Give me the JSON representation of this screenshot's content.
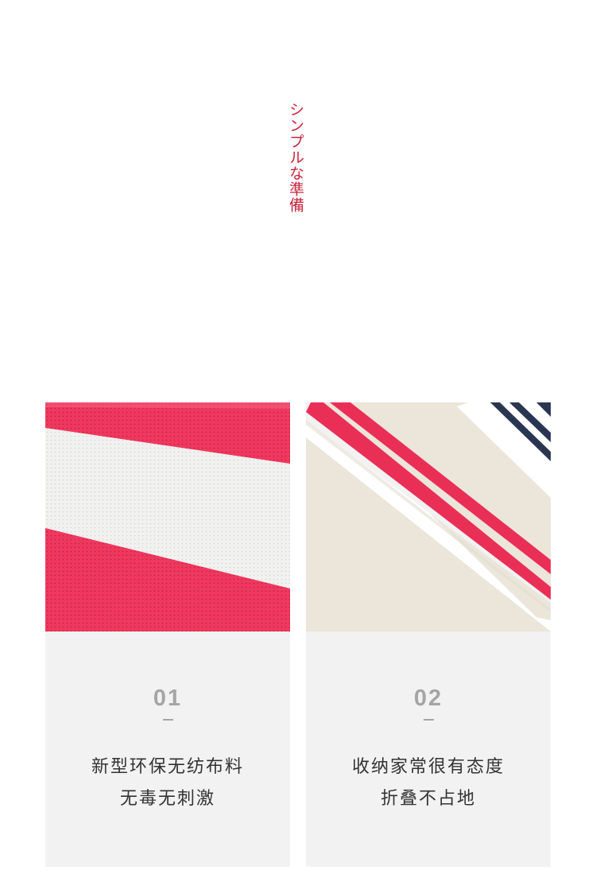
{
  "header": {
    "vertical_title": "シンプルな準備"
  },
  "cards": [
    {
      "image": "red-white-nonwoven-fabric-closeup",
      "number": "01",
      "lines": [
        "新型环保无纺布料",
        "无毒无刺激"
      ]
    },
    {
      "image": "striped-bag-edge-closeup",
      "number": "02",
      "lines": [
        "收纳家常很有态度",
        "折叠不占地"
      ]
    }
  ],
  "colors": {
    "accent": "#c8243b",
    "fabric_red": "#f0385f",
    "navy": "#2a3552",
    "beige": "#ece5da"
  }
}
